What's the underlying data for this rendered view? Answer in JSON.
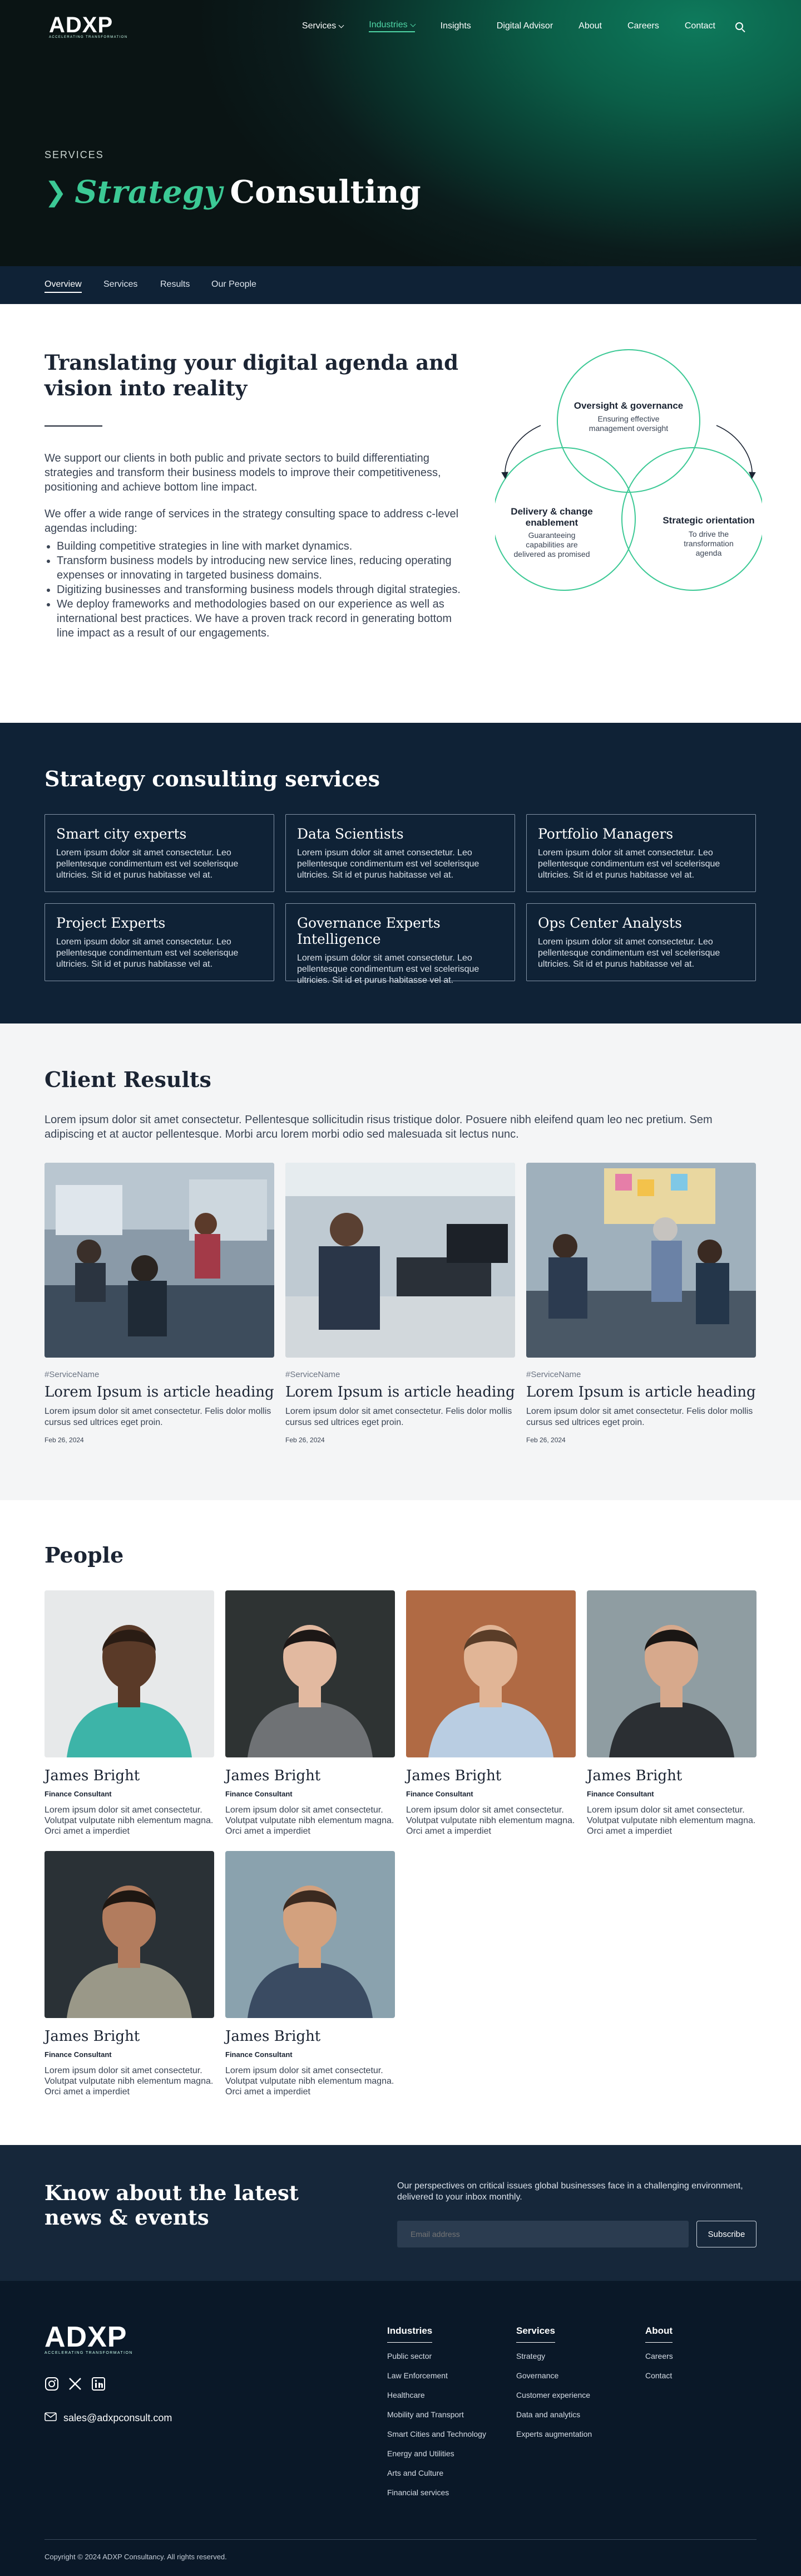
{
  "header": {
    "logo": "ADXP",
    "logo_sub": "ACCELERATING TRANSFORMATION",
    "nav": [
      {
        "label": "Services",
        "dropdown": true,
        "active": false
      },
      {
        "label": "Industries",
        "dropdown": true,
        "active": true
      },
      {
        "label": "Insights",
        "dropdown": false,
        "active": false
      },
      {
        "label": "Digital Advisor",
        "dropdown": false,
        "active": false
      },
      {
        "label": "About",
        "dropdown": false,
        "active": false
      },
      {
        "label": "Careers",
        "dropdown": false,
        "active": false
      },
      {
        "label": "Contact",
        "dropdown": false,
        "active": false
      }
    ],
    "search_icon": "search-icon"
  },
  "hero": {
    "label": "SERVICES",
    "title_accent": "Strategy",
    "title_rest": "Consulting"
  },
  "subnav": [
    "Overview",
    "Services",
    "Results",
    "Our People"
  ],
  "overview": {
    "title": "Translating your digital agenda and vision into reality",
    "para1": "We support our clients in both public and private sectors to build differentiating strategies and transform their business models to improve their competitiveness, positioning and achieve bottom line impact.",
    "para2": "We offer a wide range of services in the strategy consulting space to address c-level agendas including:",
    "bullets": [
      "Building competitive strategies in line with market dynamics.",
      "Transform business models by introducing new service lines, reducing operating expenses or innovating in targeted business domains.",
      "Digitizing businesses and transforming business models through digital strategies.",
      "We deploy frameworks and methodologies based on our experience as well as international best practices.  We have a proven track record in generating bottom line impact as a result of our engagements."
    ],
    "venn": {
      "top_title": "Oversight & governance",
      "top_text1": "Ensuring effective",
      "top_text2": "management oversight",
      "left_title1": "Delivery & change",
      "left_title2": "enablement",
      "left_text1": "Guaranteeing",
      "left_text2": "capabilities are",
      "left_text3": "delivered as promised",
      "right_title": "Strategic orientation",
      "right_text1": "To drive the",
      "right_text2": "transformation",
      "right_text3": "agenda",
      "accent": "#3cc995"
    }
  },
  "services": {
    "title": "Strategy consulting services",
    "cards": [
      {
        "title": "Smart city experts",
        "text": "Lorem ipsum dolor sit amet consectetur. Leo pellentesque condimentum est vel scelerisque ultricies. Sit id et purus habitasse vel at."
      },
      {
        "title": "Data Scientists",
        "text": "Lorem ipsum dolor sit amet consectetur. Leo pellentesque condimentum est vel scelerisque ultricies. Sit id et purus habitasse vel at."
      },
      {
        "title": "Portfolio Managers",
        "text": "Lorem ipsum dolor sit amet consectetur. Leo pellentesque condimentum est vel scelerisque ultricies. Sit id et purus habitasse vel at."
      },
      {
        "title": "Project Experts",
        "text": "Lorem ipsum dolor sit amet consectetur. Leo pellentesque condimentum est vel scelerisque ultricies. Sit id et purus habitasse vel at."
      },
      {
        "title": "Governance Experts Intelligence",
        "text": "Lorem ipsum dolor sit amet consectetur. Leo pellentesque condimentum est vel scelerisque ultricies. Sit id et purus habitasse vel at."
      },
      {
        "title": "Ops Center Analysts",
        "text": "Lorem ipsum dolor sit amet consectetur. Leo pellentesque condimentum est vel scelerisque ultricies. Sit id et purus habitasse vel at."
      }
    ]
  },
  "results": {
    "title": "Client Results",
    "intro": "Lorem ipsum dolor sit amet consectetur. Pellentesque sollicitudin risus tristique dolor. Posuere nibh eleifend quam leo nec pretium. Sem adipiscing et at auctor pellentesque. Morbi arcu lorem morbi odio sed malesuada sit lectus nunc.",
    "cards": [
      {
        "tag": "#ServiceName",
        "title": "Lorem Ipsum is article heading",
        "text": "Lorem ipsum dolor sit amet consectetur. Felis dolor mollis cursus sed ultrices eget proin.",
        "date": "Feb 26, 2024"
      },
      {
        "tag": "#ServiceName",
        "title": "Lorem Ipsum is article heading",
        "text": "Lorem ipsum dolor sit amet consectetur. Felis dolor mollis cursus sed ultrices eget proin.",
        "date": "Feb 26, 2024"
      },
      {
        "tag": "#ServiceName",
        "title": "Lorem Ipsum is article heading",
        "text": "Lorem ipsum dolor sit amet consectetur. Felis dolor mollis cursus sed ultrices eget proin.",
        "date": "Feb 26, 2024"
      }
    ]
  },
  "people": {
    "title": "People",
    "members": [
      {
        "name": "James Bright",
        "role": "Finance Consultant",
        "text": "Lorem ipsum dolor sit amet consectetur. Volutpat vulputate nibh elementum magna. Orci amet a imperdiet"
      },
      {
        "name": "James Bright",
        "role": "Finance Consultant",
        "text": "Lorem ipsum dolor sit amet consectetur. Volutpat vulputate nibh elementum magna. Orci amet a imperdiet"
      },
      {
        "name": "James Bright",
        "role": "Finance Consultant",
        "text": "Lorem ipsum dolor sit amet consectetur. Volutpat vulputate nibh elementum magna. Orci amet a imperdiet"
      },
      {
        "name": "James Bright",
        "role": "Finance Consultant",
        "text": "Lorem ipsum dolor sit amet consectetur. Volutpat vulputate nibh elementum magna. Orci amet a imperdiet"
      },
      {
        "name": "James Bright",
        "role": "Finance Consultant",
        "text": "Lorem ipsum dolor sit amet consectetur. Volutpat vulputate nibh elementum magna. Orci amet a imperdiet"
      },
      {
        "name": "James Bright",
        "role": "Finance Consultant",
        "text": "Lorem ipsum dolor sit amet consectetur. Volutpat vulputate nibh elementum magna. Orci amet a imperdiet"
      }
    ]
  },
  "newsletter": {
    "title": "Know about the latest news & events",
    "text": "Our perspectives on critical issues global businesses face in a challenging environment, delivered to your inbox monthly.",
    "placeholder": "Email address",
    "button": "Subscribe"
  },
  "footer": {
    "logo": "ADXP",
    "logo_sub": "ACCELERATING TRANSFORMATION",
    "social": [
      "instagram-icon",
      "x-icon",
      "linkedin-icon"
    ],
    "email": "sales@adxpconsult.com",
    "columns": [
      {
        "title": "Industries",
        "links": [
          "Public sector",
          "Law Enforcement",
          "Healthcare",
          "Mobility and Transport",
          "Smart Cities and Technology",
          "Energy and Utilities",
          "Arts and Culture",
          "Financial services"
        ]
      },
      {
        "title": "Services",
        "links": [
          "Strategy",
          "Governance",
          "Customer experience",
          "Data and analytics",
          "Experts augmentation"
        ]
      },
      {
        "title": "About",
        "links": [
          "Careers",
          "Contact"
        ]
      }
    ],
    "copyright": "Copyright © 2024 ADXP Consultancy. All rights reserved."
  }
}
